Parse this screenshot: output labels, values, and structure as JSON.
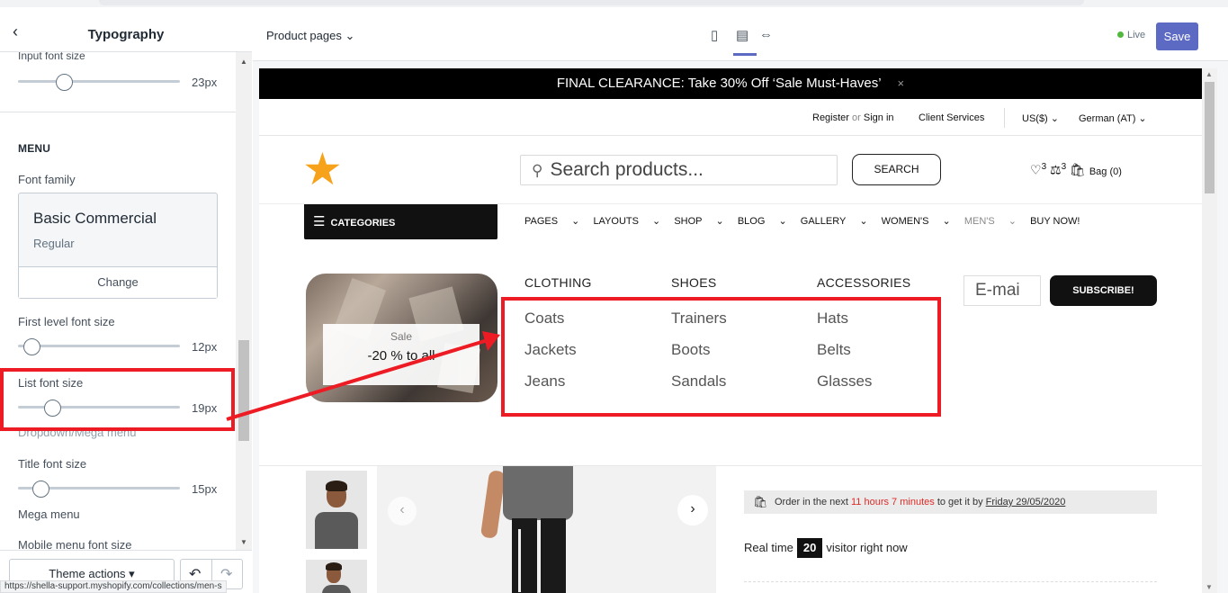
{
  "sidebar": {
    "title": "Typography",
    "back_icon": "chevron-left-icon",
    "input_font_size_label": "Input font size",
    "input_font_size_value": "23px",
    "menu_section": "MENU",
    "font_family_label": "Font family",
    "font_name": "Basic Commercial",
    "font_style": "Regular",
    "change_label": "Change",
    "first_level_label": "First level font size",
    "first_level_value": "12px",
    "list_font_label": "List font size",
    "list_font_value": "19px",
    "dropdown_label": "Dropdown/Mega menu",
    "title_font_label": "Title font size",
    "title_font_value": "15px",
    "mega_menu_label": "Mega menu",
    "mobile_menu_label": "Mobile menu font size",
    "theme_actions_label": "Theme actions",
    "slider_levels": {
      "input": 0.3,
      "first_level": 0.08,
      "list": 0.22,
      "title": 0.15
    }
  },
  "status_url": "https://shella-support.myshopify.com/collections/men-s",
  "topbar": {
    "page_select": "Product pages",
    "live_label": "Live",
    "save_label": "Save",
    "accent_color": "#5c6ac4",
    "live_color": "#50b83c"
  },
  "store": {
    "promo_text": "FINAL CLEARANCE: Take 30% Off ‘Sale Must-Haves’",
    "promo_close": "×",
    "register": "Register",
    "or": "or",
    "sign_in": "Sign in",
    "client_services": "Client Services",
    "currency": "US($)",
    "language": "German (AT)",
    "search_placeholder": "Search products...",
    "search_button": "SEARCH",
    "wishlist_count": "3",
    "compare_count": "3",
    "bag_label": "Bag (0)",
    "categories_label": "CATEGORIES",
    "nav": [
      "PAGES",
      "LAYOUTS",
      "SHOP",
      "BLOG",
      "GALLERY",
      "WOMEN'S",
      "MEN'S",
      "BUY NOW!"
    ],
    "sale_label": "Sale",
    "sale_text": "-20 % to all",
    "columns": [
      {
        "title": "CLOTHING",
        "items": [
          "Coats",
          "Jackets",
          "Jeans"
        ]
      },
      {
        "title": "SHOES",
        "items": [
          "Trainers",
          "Boots",
          "Sandals"
        ]
      },
      {
        "title": "ACCESSORIES",
        "items": [
          "Hats",
          "Belts",
          "Glasses"
        ]
      }
    ],
    "email_placeholder": "E-mai",
    "subscribe_label": "SUBSCRIBE!",
    "order_prefix": "Order in the next",
    "order_time": "11 hours 7 minutes",
    "order_mid": "to get it by",
    "order_date": "Friday 29/05/2020",
    "realtime_prefix": "Real time",
    "realtime_count": "20",
    "realtime_suffix": "visitor right now",
    "logo_color": "#f7a21b",
    "annotation_color": "#ed1c24"
  }
}
